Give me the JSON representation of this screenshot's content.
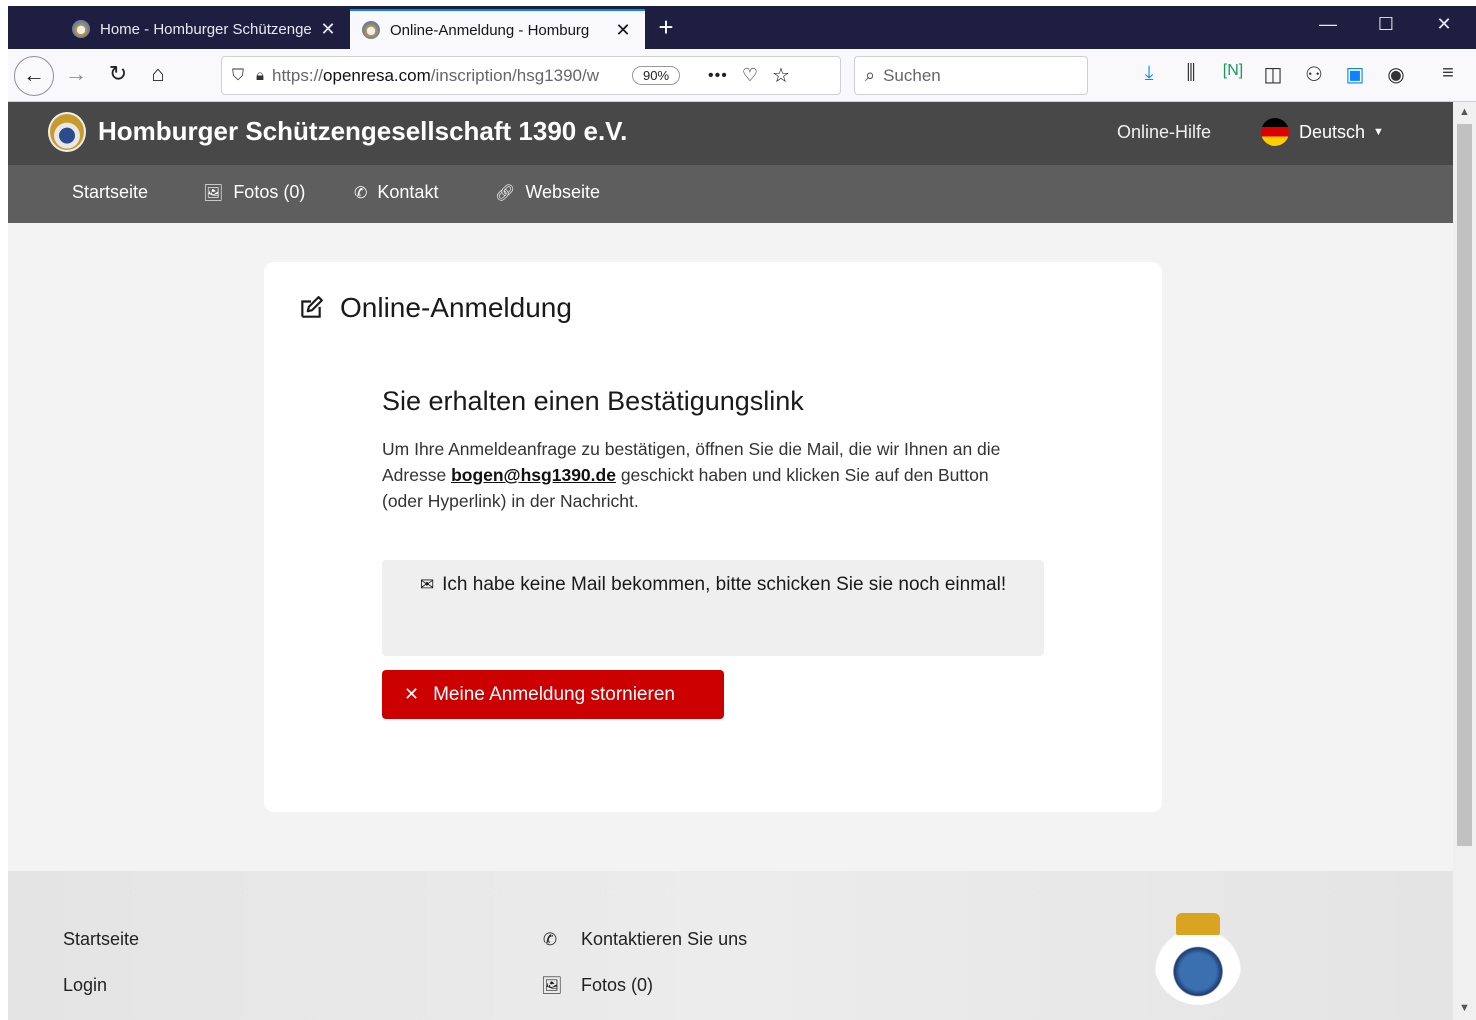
{
  "browser": {
    "tabs": [
      {
        "title": "Home - Homburger Schützenge",
        "close": "✕"
      },
      {
        "title": "Online-Anmeldung - Homburg",
        "close": "✕"
      }
    ],
    "new_tab": "+",
    "url_prefix": "https://",
    "url_domain": "openresa.com",
    "url_path": "/inscription/hsg1390/w",
    "zoom": "90%",
    "search_placeholder": "Suchen",
    "window_controls": {
      "minimize": "—",
      "maximize": "☐",
      "close": "✕"
    }
  },
  "site": {
    "title": "Homburger Schützengesellschaft 1390 e.V.",
    "help": "Online-Hilfe",
    "language": "Deutsch"
  },
  "nav": {
    "home": "Startseite",
    "photos": "Fotos (0)",
    "contact": "Kontakt",
    "website": "Webseite"
  },
  "card": {
    "heading": "Online-Anmeldung",
    "confirm_title": "Sie erhalten einen Bestätigungslink",
    "text_before": "Um Ihre Anmeldeanfrage zu bestätigen, öffnen Sie die Mail, die wir Ihnen an die Adresse ",
    "email": "bogen@hsg1390.de",
    "text_after": " geschickt haben und klicken Sie auf den Button (oder Hyperlink) in der Nachricht.",
    "resend_label": "Ich habe keine Mail bekommen, bitte schicken Sie sie noch einmal!",
    "cancel_label": "Meine Anmeldung stornieren"
  },
  "footer": {
    "home": "Startseite",
    "login": "Login",
    "contact": "Kontaktieren Sie uns",
    "photos": "Fotos (0)"
  },
  "colors": {
    "header_bg": "#484848",
    "nav_bg": "#5e5e5e",
    "cancel_red": "#cc0000",
    "tab_accent": "#0a84ff"
  }
}
